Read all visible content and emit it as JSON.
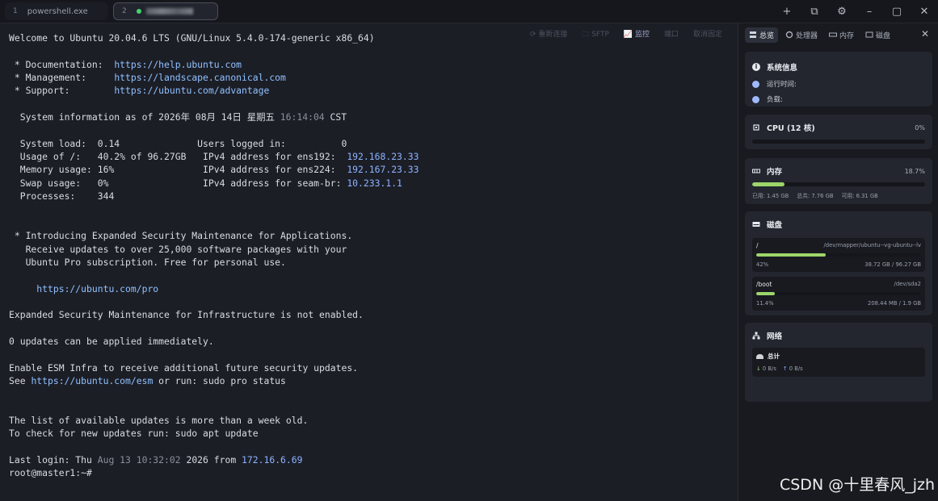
{
  "tabs": [
    {
      "num": "1",
      "label": "powershell.exe"
    },
    {
      "num": "2",
      "label": ""
    }
  ],
  "window_controls": [
    "+",
    "⧉",
    "⚙",
    "–",
    "▢",
    "✕"
  ],
  "term_toolbar": [
    "⟳ 重新连接",
    "🗀 SFTP",
    "📈 监控",
    "端口",
    "取消固定"
  ],
  "terminal": {
    "welcome": "Welcome to Ubuntu 20.04.6 LTS (GNU/Linux 5.4.0-174-generic x86_64)",
    "doc_label": " * Documentation:  ",
    "doc_url": "https://help.ubuntu.com",
    "mgmt_label": " * Management:     ",
    "mgmt_url": "https://landscape.canonical.com",
    "support_label": " * Support:        ",
    "support_url": "https://ubuntu.com/advantage",
    "sysinfo_prefix": "  System information as of 2026年 08月 14日 星期五 ",
    "sysinfo_time": "16:14:04",
    "sysinfo_suffix": " CST",
    "load": "  System load:  0.14              Users logged in:          0",
    "usage_prefix": "  Usage of /:   40.2% of 96.27GB   IPv4 address for ens192:  ",
    "ip1": "192.168.23.33",
    "mem_prefix": "  Memory usage: 16%                IPv4 address for ens224:  ",
    "ip2": "192.167.23.33",
    "swap_prefix": "  Swap usage:   0%                 IPv4 address for seam-br: ",
    "ip3": "10.233.1.1",
    "processes": "  Processes:    344",
    "esm1": " * Introducing Expanded Security Maintenance for Applications.",
    "esm2": "   Receive updates to over 25,000 software packages with your",
    "esm3": "   Ubuntu Pro subscription. Free for personal use.",
    "pro_url": "     https://ubuntu.com/pro",
    "infra": "Expanded Security Maintenance for Infrastructure is not enabled.",
    "updates": "0 updates can be applied immediately.",
    "enable": "Enable ESM Infra to receive additional future security updates.",
    "see_prefix": "See ",
    "see_url": "https://ubuntu.com/esm",
    "see_suffix": " or run: sudo pro status",
    "list_old": "The list of available updates is more than a week old.",
    "check": "To check for new updates run: sudo apt update",
    "last_prefix": "Last login: Thu ",
    "last_date": "Aug 13 10:32:02",
    "last_mid": " 2026 from ",
    "last_ip": "172.16.6.69",
    "prompt": "root@master1:~#"
  },
  "sidebar": {
    "tabs": [
      "总览",
      "处理器",
      "内存",
      "磁盘"
    ],
    "sysinfo_title": "系统信息",
    "uptime_label": "运行时间:",
    "load_label": "负载:",
    "cpu_title": "CPU (12 核)",
    "cpu_pct": "0%",
    "cpu_value": 0,
    "mem_title": "内存",
    "mem_pct": "18.7%",
    "mem_value": 18.7,
    "mem_used": "已用: 1.45 GB",
    "mem_total": "总共: 7.76 GB",
    "mem_avail": "可用: 6.31 GB",
    "disk_title": "磁盘",
    "disks": [
      {
        "mount": "/",
        "dev": "/dev/mapper/ubuntu--vg-ubuntu--lv",
        "pct": "42%",
        "value": 42,
        "usage": "38.72 GB / 96.27 GB"
      },
      {
        "mount": "/boot",
        "dev": "/dev/sda2",
        "pct": "11.4%",
        "value": 11.4,
        "usage": "208.44 MB / 1.9 GB"
      }
    ],
    "net_title": "网络",
    "net_total": "总计",
    "net_down": "0 B/s",
    "net_up": "0 B/s"
  },
  "watermark": "CSDN @十里春风_jzh"
}
